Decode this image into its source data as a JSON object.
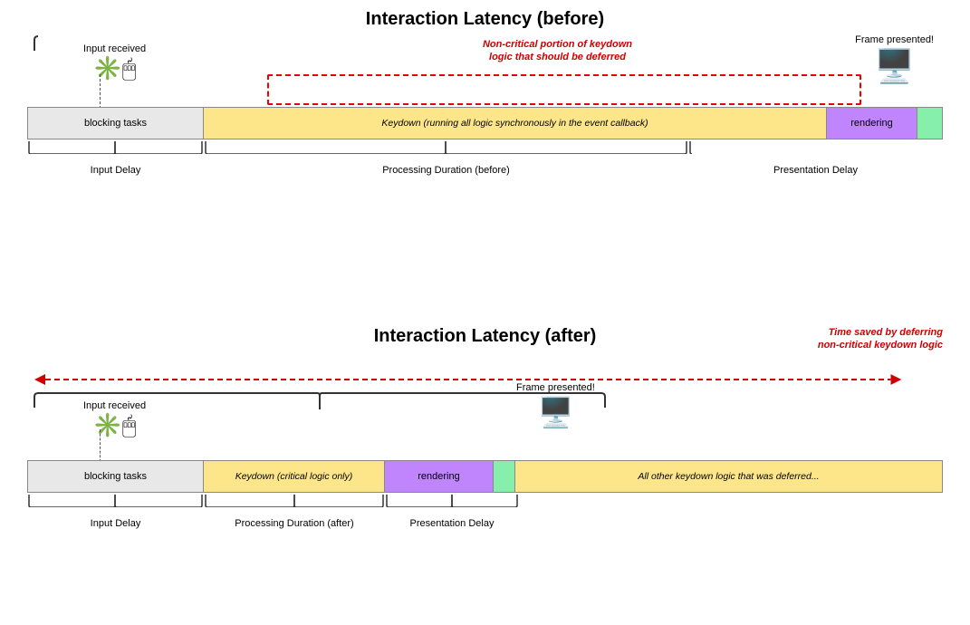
{
  "top": {
    "title": "Interaction Latency (before)",
    "input_received": "Input received",
    "frame_presented": "Frame presented!",
    "annotation_red": "Non-critical portion of keydown\nlogic that should be deferred",
    "bar_blocking": "blocking tasks",
    "bar_keydown": "Keydown (running all logic synchronously in the event callback)",
    "bar_rendering": "rendering",
    "label_input_delay": "Input Delay",
    "label_processing": "Processing Duration (before)",
    "label_presentation": "Presentation Delay"
  },
  "bottom": {
    "title": "Interaction Latency (after)",
    "input_received": "Input received",
    "frame_presented": "Frame presented!",
    "time_saved": "Time saved by deferring\nnon-critical keydown logic",
    "bar_blocking": "blocking tasks",
    "bar_keydown": "Keydown (critical logic only)",
    "bar_rendering": "rendering",
    "bar_deferred": "All other keydown logic that was deferred...",
    "label_input_delay": "Input Delay",
    "label_processing": "Processing Duration (after)",
    "label_presentation": "Presentation Delay"
  }
}
